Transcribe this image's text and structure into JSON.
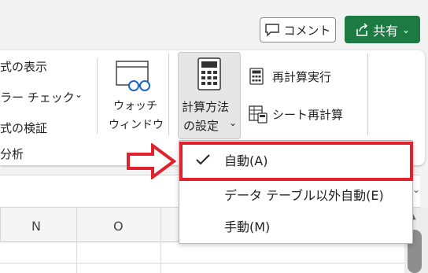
{
  "header": {
    "comment_label": "コメント",
    "share_label": "共有"
  },
  "ribbon": {
    "left_items": [
      "式の表示",
      "ラー チェック",
      "式の検証",
      "分析"
    ],
    "watch_window_line1": "ウォッチ",
    "watch_window_line2": "ウィンドウ",
    "calc_options_line1": "計算方法",
    "calc_options_line2": "の設定",
    "calc_now": "再計算実行",
    "calc_sheet": "シート再計算"
  },
  "sheet": {
    "columns": [
      "N",
      "O"
    ]
  },
  "menu": {
    "items": [
      {
        "label": "自動(A)",
        "checked": true
      },
      {
        "label": "データ テーブル以外自動(E)",
        "checked": false
      },
      {
        "label": "手動(M)",
        "checked": false
      }
    ]
  },
  "colors": {
    "share_green": "#1e7a43",
    "highlight_red": "#e1222c"
  }
}
